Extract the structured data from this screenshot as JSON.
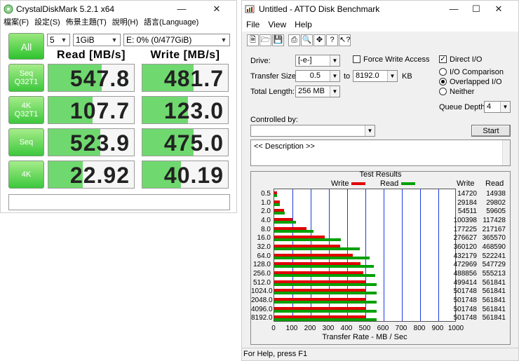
{
  "cdm": {
    "title": "CrystalDiskMark 5.2.1 x64",
    "menu": [
      "檔案(F)",
      "設定(S)",
      "佈景主題(T)",
      "說明(H)",
      "語言(Language)"
    ],
    "all_label": "All",
    "count": "5",
    "size": "1GiB",
    "drive": "E: 0% (0/477GiB)",
    "read_header": "Read [MB/s]",
    "write_header": "Write [MB/s]",
    "rows": [
      {
        "label": "Seq\nQ32T1",
        "read": "547.8",
        "write": "481.7",
        "read_frac": 0.62,
        "write_frac": 0.6
      },
      {
        "label": "4K\nQ32T1",
        "read": "107.7",
        "write": "123.0",
        "read_frac": 0.52,
        "write_frac": 0.53
      },
      {
        "label": "Seq",
        "read": "523.9",
        "write": "475.0",
        "read_frac": 0.61,
        "write_frac": 0.6
      },
      {
        "label": "4K",
        "read": "22.92",
        "write": "40.19",
        "read_frac": 0.4,
        "write_frac": 0.45
      }
    ]
  },
  "atto": {
    "title": "Untitled - ATTO Disk Benchmark",
    "menu": [
      "File",
      "View",
      "Help"
    ],
    "toolbar_icons": [
      "new-icon",
      "open-icon",
      "save-icon",
      "print-icon",
      "print-preview-icon",
      "move-icon",
      "help-icon",
      "context-help-icon"
    ],
    "drive_label": "Drive:",
    "drive_value": "[-e-]",
    "force_write_label": "Force Write Access",
    "direct_io_label": "Direct I/O",
    "transfer_size_label": "Transfer Size:",
    "ts_from": "0.5",
    "ts_to_label": "to",
    "ts_to": "8192.0",
    "kb_label": "KB",
    "io_comparison_label": "I/O Comparison",
    "overlapped_io_label": "Overlapped I/O",
    "neither_label": "Neither",
    "total_length_label": "Total Length:",
    "total_length_value": "256 MB",
    "queue_depth_label": "Queue Depth:",
    "queue_depth_value": "4",
    "controlled_by_label": "Controlled by:",
    "start_label": "Start",
    "description": "<< Description >>",
    "status": "For Help, press F1",
    "direct_io_checked": true,
    "force_write_checked": false,
    "io_mode": "overlapped"
  },
  "chart_data": {
    "type": "bar",
    "title": "Test Results",
    "xlabel": "Transfer Rate - MB / Sec",
    "xlim": [
      0,
      1000
    ],
    "xticks": [
      "0",
      "100",
      "200",
      "300",
      "400",
      "500",
      "600",
      "700",
      "800",
      "900",
      "1000"
    ],
    "categories": [
      "0.5",
      "1.0",
      "2.0",
      "4.0",
      "8.0",
      "16.0",
      "32.0",
      "64.0",
      "128.0",
      "256.0",
      "512.0",
      "1024.0",
      "2048.0",
      "4096.0",
      "8192.0"
    ],
    "write_col_label": "Write",
    "read_col_label": "Read",
    "series": [
      {
        "name": "Write",
        "color": "#e00000",
        "values": [
          14720,
          29184,
          54511,
          100398,
          177225,
          276627,
          360120,
          432179,
          472969,
          488856,
          499414,
          501748,
          501748,
          501748,
          501748
        ]
      },
      {
        "name": "Read",
        "color": "#00a000",
        "values": [
          14938,
          29802,
          59605,
          117428,
          217167,
          365570,
          468590,
          522241,
          547729,
          555213,
          561841,
          561841,
          561841,
          561841,
          561841
        ]
      }
    ]
  }
}
